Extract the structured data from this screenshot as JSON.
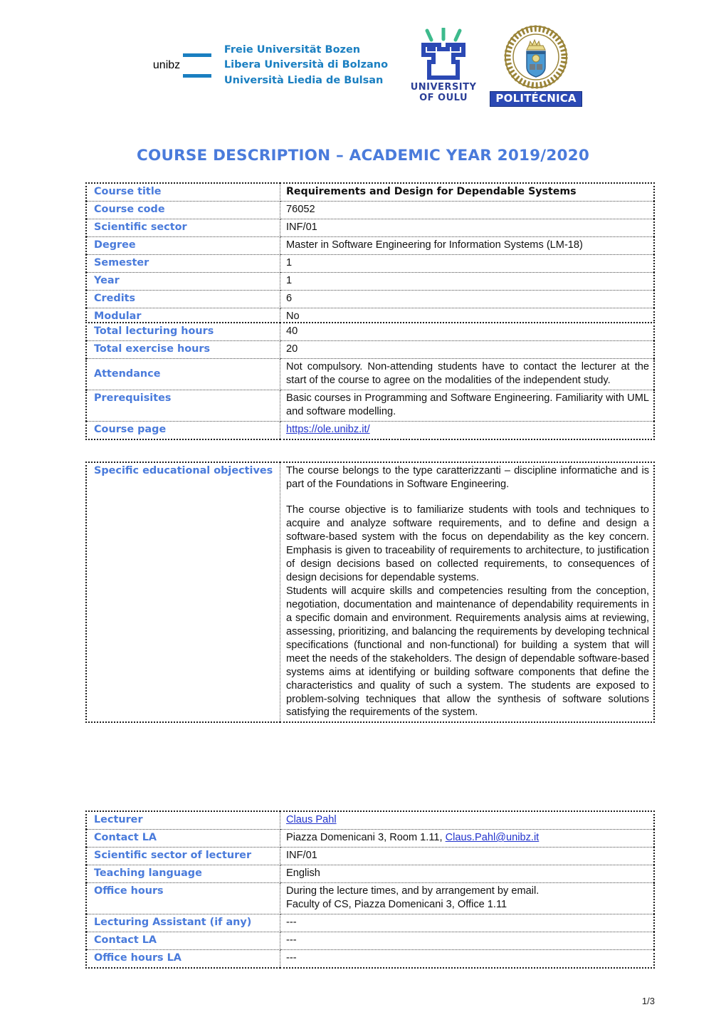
{
  "header": {
    "logos": [
      {
        "name": "unibz-logo",
        "wordmark": "unibz",
        "lines": [
          "Freie Universität Bozen",
          "Libera Università di Bolzano",
          "Università Liedia de Bulsan"
        ],
        "color": "#1a7fc1"
      },
      {
        "name": "university-of-oulu-logo",
        "line1": "UNIVERSITY",
        "line2": "OF OULU",
        "color": "#2b3f97",
        "accent": "#3dba8c"
      },
      {
        "name": "politecnica-logo",
        "band": "POLITÉCNICA",
        "color": "#2b49b4",
        "seal_color": "#9a8438"
      }
    ]
  },
  "title": "COURSE DESCRIPTION – ACADEMIC YEAR 2019/2020",
  "colors": {
    "label_blue": "#4a7bdb",
    "link_blue": "#2233cc"
  },
  "tables": {
    "basic": [
      {
        "label": "Course title",
        "value": "Requirements and Design for Dependable Systems",
        "bold": true
      },
      {
        "label": "Course code",
        "value": "76052"
      },
      {
        "label": "Scientific sector",
        "value": "INF/01"
      },
      {
        "label": "Degree",
        "value": "Master in Software Engineering for Information Systems (LM-18)"
      },
      {
        "label": "Semester",
        "value": "1"
      },
      {
        "label": "Year",
        "value": "1"
      },
      {
        "label": "Credits",
        "value": "6"
      },
      {
        "label": "Modular",
        "value": "No"
      }
    ],
    "hours": [
      {
        "label": "Total lecturing hours",
        "value": "40"
      },
      {
        "label": "Total exercise hours",
        "value": "20"
      },
      {
        "label": "Attendance",
        "value": "Not compulsory. Non-attending students have to contact the lecturer at the start of the course to agree on the modalities of the independent study."
      },
      {
        "label": "Prerequisites",
        "value": "Basic courses in Programming and Software Engineering. Familiarity with UML and software modelling."
      },
      {
        "label": "Course page",
        "value": "https://ole.unibz.it/",
        "link": true
      }
    ],
    "objectives": {
      "label": "Specific educational objectives",
      "paragraphs": [
        "The course belongs to the type caratterizzanti – discipline informatiche and is part of the Foundations in Software Engineering.",
        "The course objective is to familiarize students with tools and techniques to acquire and analyze software requirements, and to define and design a software-based system with the focus on dependability as the key concern. Emphasis is given to traceability of requirements to architecture, to justification of design decisions based on collected requirements, to consequences of design decisions for dependable systems.",
        "Students will acquire skills and competencies resulting from the conception, negotiation, documentation and maintenance of dependability requirements in a specific domain and environment. Requirements analysis aims at reviewing, assessing, prioritizing, and balancing the requirements by developing technical specifications (functional and non-functional) for building a system that will meet the needs of the stakeholders. The design of dependable software-based systems aims at identifying or building software components that define the characteristics and quality of such a system. The students are exposed to problem-solving techniques that allow the synthesis of software solutions satisfying the requirements of the system."
      ]
    },
    "lecturer": [
      {
        "label": "Lecturer",
        "value": "Claus Pahl",
        "link": true
      },
      {
        "label": "Contact LA",
        "value": "Piazza Domenicani 3, Room 1.11, ",
        "link_text": "Claus.Pahl@unibz.it"
      },
      {
        "label": "Scientific sector of lecturer",
        "value": "INF/01"
      },
      {
        "label": "Teaching language",
        "value": "English"
      },
      {
        "label": "Office hours",
        "value": "During the lecture times, and by arrangement by email.",
        "value2": "Faculty of CS, Piazza Domenicani 3, Office 1.11"
      },
      {
        "label": "Lecturing Assistant (if any)",
        "value": "---"
      },
      {
        "label": "Contact LA",
        "value": "---"
      },
      {
        "label": "Office hours LA",
        "value": "---"
      }
    ]
  },
  "footer": {
    "page": "1/3"
  }
}
